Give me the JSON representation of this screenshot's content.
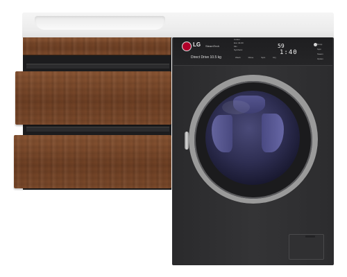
{
  "washer": {
    "brand": "LG",
    "tagline": "SteamTech",
    "capacity_label": "Direct Drive 10.5 kg",
    "program_lines": [
      "Cotton",
      "Eco 40-60",
      "Mix",
      "Synthetic",
      "Allergy Care",
      "Baby Care",
      "Sport Wear",
      "Quick 30"
    ],
    "status_labels": [
      "Wash",
      "Rinse",
      "Spin",
      "Dry"
    ],
    "display_top": "59",
    "display_bottom": "1:40",
    "right_labels": [
      "Temp",
      "Spin",
      "Steam",
      "Option"
    ]
  },
  "colors": {
    "wood": "#7a4a2b",
    "washer_body": "#2f2f31",
    "glass": "#3a3a66",
    "countertop": "#efefef"
  }
}
